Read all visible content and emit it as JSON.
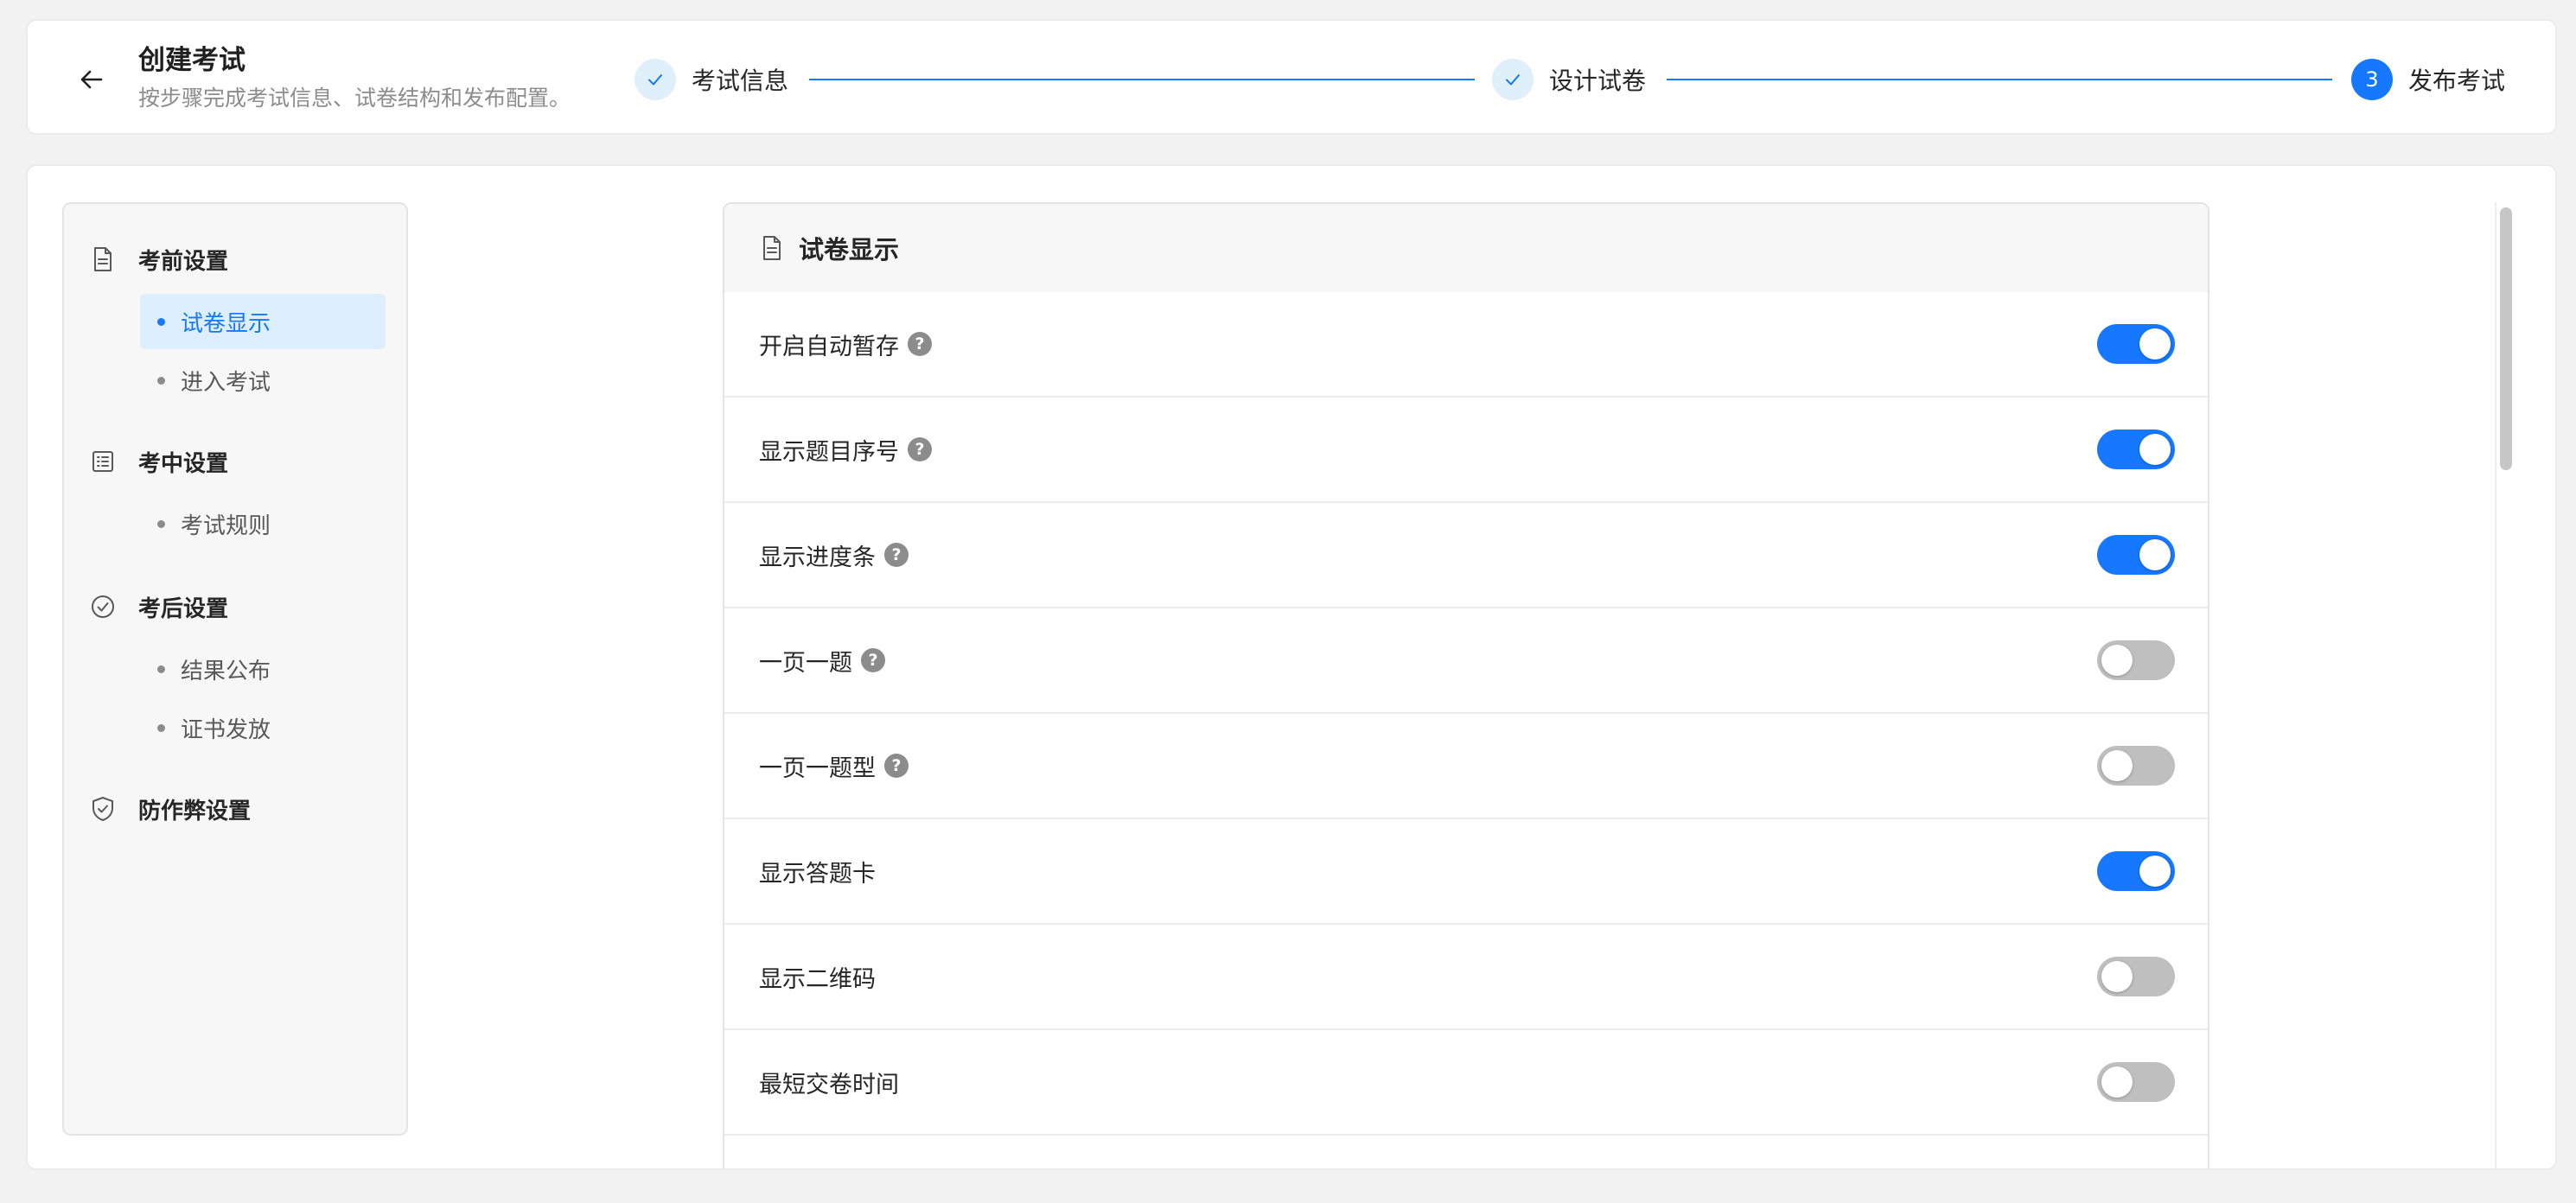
{
  "header": {
    "back_icon": "arrow-left-icon",
    "title": "创建考试",
    "subtitle": "按步骤完成考试信息、试卷结构和发布配置。",
    "steps": [
      {
        "label": "考试信息",
        "status": "done",
        "icon": "check-icon"
      },
      {
        "label": "设计试卷",
        "status": "done",
        "icon": "check-icon"
      },
      {
        "label": "发布考试",
        "status": "active",
        "number": "3"
      }
    ]
  },
  "sidebar": {
    "groups": [
      {
        "title": "考前设置",
        "icon": "document-icon",
        "items": [
          {
            "label": "试卷显示",
            "active": true
          },
          {
            "label": "进入考试",
            "active": false
          }
        ]
      },
      {
        "title": "考中设置",
        "icon": "list-icon",
        "items": [
          {
            "label": "考试规则",
            "active": false
          }
        ]
      },
      {
        "title": "考后设置",
        "icon": "check-circle-icon",
        "items": [
          {
            "label": "结果公布",
            "active": false
          },
          {
            "label": "证书发放",
            "active": false
          }
        ]
      },
      {
        "title": "防作弊设置",
        "icon": "shield-check-icon",
        "items": []
      }
    ]
  },
  "panel": {
    "title": "试卷显示",
    "icon": "document-icon",
    "help_glyph": "?",
    "rows": [
      {
        "label": "开启自动暂存",
        "help": true,
        "on": true
      },
      {
        "label": "显示题目序号",
        "help": true,
        "on": true
      },
      {
        "label": "显示进度条",
        "help": true,
        "on": true
      },
      {
        "label": "一页一题",
        "help": true,
        "on": false
      },
      {
        "label": "一页一题型",
        "help": true,
        "on": false
      },
      {
        "label": "显示答题卡",
        "help": false,
        "on": true
      },
      {
        "label": "显示二维码",
        "help": false,
        "on": false
      },
      {
        "label": "最短交卷时间",
        "help": false,
        "on": false
      }
    ]
  },
  "colors": {
    "accent": "#1677ff",
    "toggle_off": "#bfbfbf",
    "step_done_bg": "#e0f0fb",
    "nav_active_bg": "#ddeeff"
  }
}
